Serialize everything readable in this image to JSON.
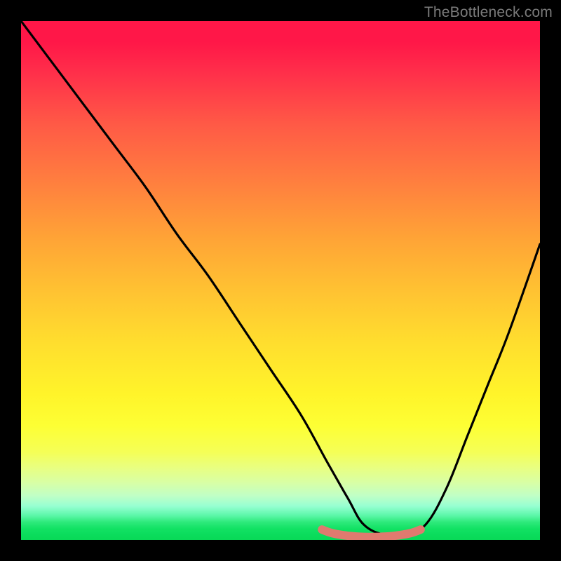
{
  "attribution": "TheBottleneck.com",
  "colors": {
    "frame": "#000000",
    "curve_stroke": "#000000",
    "optimal_band": "#e07a6f",
    "gradient_top": "#ff1748",
    "gradient_bottom": "#08d957"
  },
  "chart_data": {
    "type": "line",
    "title": "",
    "xlabel": "",
    "ylabel": "",
    "xlim": [
      0,
      100
    ],
    "ylim": [
      0,
      100
    ],
    "y_axis_inverted_meaning": "lower y = better (green); higher y = worse (red)",
    "series": [
      {
        "name": "bottleneck-curve",
        "x": [
          0,
          6,
          12,
          18,
          24,
          30,
          36,
          42,
          48,
          54,
          59,
          63,
          66,
          70,
          74,
          78,
          82,
          86,
          90,
          94,
          100
        ],
        "values": [
          100,
          92,
          84,
          76,
          68,
          59,
          51,
          42,
          33,
          24,
          15,
          8,
          3,
          1,
          1,
          3,
          10,
          20,
          30,
          40,
          57
        ]
      },
      {
        "name": "optimal-band",
        "x": [
          58,
          60,
          63,
          66,
          69,
          72,
          75,
          77
        ],
        "values": [
          2,
          1.3,
          0.8,
          0.6,
          0.6,
          0.8,
          1.3,
          2
        ]
      }
    ],
    "annotations": []
  }
}
